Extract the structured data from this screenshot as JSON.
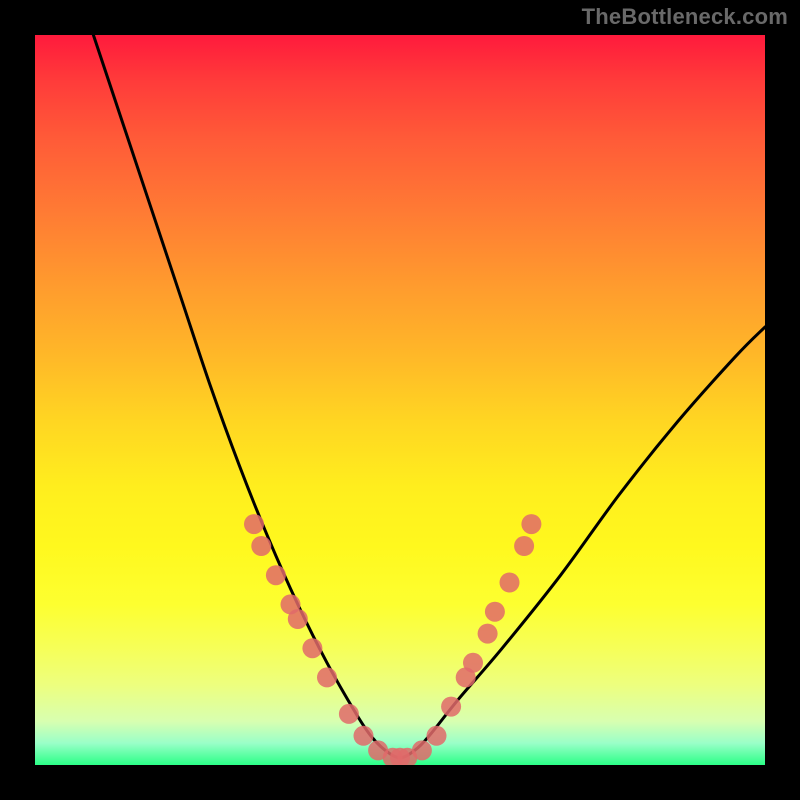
{
  "attribution": "TheBottleneck.com",
  "chart_data": {
    "type": "line",
    "title": "",
    "xlabel": "",
    "ylabel": "",
    "xlim": [
      0,
      100
    ],
    "ylim": [
      0,
      100
    ],
    "series": [
      {
        "name": "bottleneck-curve",
        "x": [
          8,
          12,
          16,
          20,
          24,
          28,
          32,
          36,
          40,
          44,
          46,
          48,
          50,
          52,
          54,
          58,
          64,
          72,
          80,
          88,
          96,
          100
        ],
        "y": [
          100,
          88,
          76,
          64,
          52,
          41,
          31,
          22,
          14,
          7,
          4,
          2,
          1,
          2,
          4,
          9,
          16,
          26,
          37,
          47,
          56,
          60
        ]
      }
    ],
    "markers": {
      "name": "highlighted-points",
      "color": "#e06a6a",
      "points": [
        {
          "x": 30,
          "y": 33
        },
        {
          "x": 31,
          "y": 30
        },
        {
          "x": 33,
          "y": 26
        },
        {
          "x": 35,
          "y": 22
        },
        {
          "x": 36,
          "y": 20
        },
        {
          "x": 38,
          "y": 16
        },
        {
          "x": 40,
          "y": 12
        },
        {
          "x": 43,
          "y": 7
        },
        {
          "x": 45,
          "y": 4
        },
        {
          "x": 47,
          "y": 2
        },
        {
          "x": 49,
          "y": 1
        },
        {
          "x": 50,
          "y": 1
        },
        {
          "x": 51,
          "y": 1
        },
        {
          "x": 53,
          "y": 2
        },
        {
          "x": 55,
          "y": 4
        },
        {
          "x": 57,
          "y": 8
        },
        {
          "x": 59,
          "y": 12
        },
        {
          "x": 60,
          "y": 14
        },
        {
          "x": 62,
          "y": 18
        },
        {
          "x": 63,
          "y": 21
        },
        {
          "x": 65,
          "y": 25
        },
        {
          "x": 67,
          "y": 30
        },
        {
          "x": 68,
          "y": 33
        }
      ]
    },
    "gradient_stops": [
      {
        "pos": 0.0,
        "color": "#ff1a3c"
      },
      {
        "pos": 0.5,
        "color": "#ffd020"
      },
      {
        "pos": 0.8,
        "color": "#fbff40"
      },
      {
        "pos": 1.0,
        "color": "#2bff87"
      }
    ]
  }
}
